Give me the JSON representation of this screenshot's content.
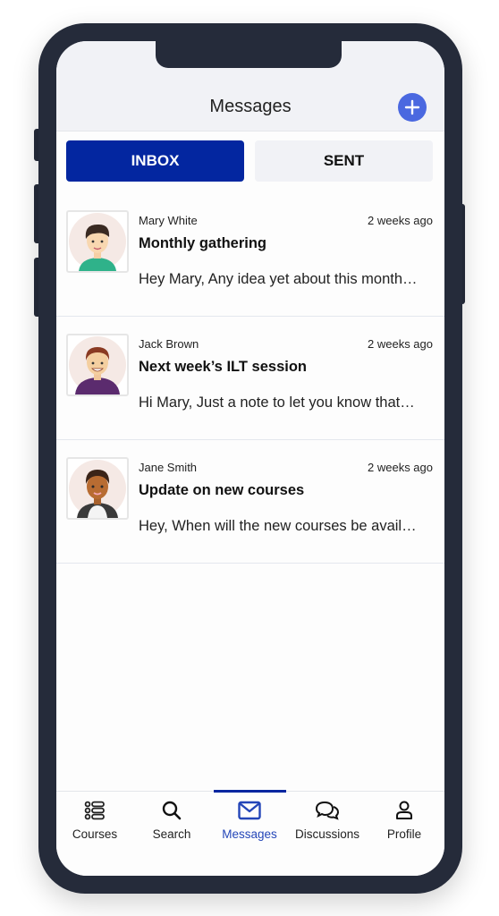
{
  "header": {
    "title": "Messages",
    "add_icon": "plus-icon",
    "accent_color": "#4a68e0"
  },
  "tabs": [
    {
      "label": "INBOX",
      "active": true
    },
    {
      "label": "SENT",
      "active": false
    }
  ],
  "messages": [
    {
      "sender": "Mary White",
      "time": "2 weeks ago",
      "subject": "Monthly gathering",
      "preview": "Hey Mary, Any idea yet about this month…",
      "avatar": "avatar-mary-white"
    },
    {
      "sender": "Jack Brown",
      "time": "2 weeks ago",
      "subject": "Next week’s ILT session",
      "preview": "Hi Mary, Just a note to let you know that…",
      "avatar": "avatar-jack-brown"
    },
    {
      "sender": "Jane Smith",
      "time": "2 weeks ago",
      "subject": "Update on new courses",
      "preview": "Hey, When will the new courses be avail…",
      "avatar": "avatar-jane-smith"
    }
  ],
  "bottom_nav": {
    "items": [
      {
        "label": "Courses",
        "icon": "courses-icon",
        "active": false
      },
      {
        "label": "Search",
        "icon": "search-icon",
        "active": false
      },
      {
        "label": "Messages",
        "icon": "mail-icon",
        "active": true
      },
      {
        "label": "Discussions",
        "icon": "discussions-icon",
        "active": false
      },
      {
        "label": "Profile",
        "icon": "profile-icon",
        "active": false
      }
    ],
    "active_color": "#0326a0"
  }
}
